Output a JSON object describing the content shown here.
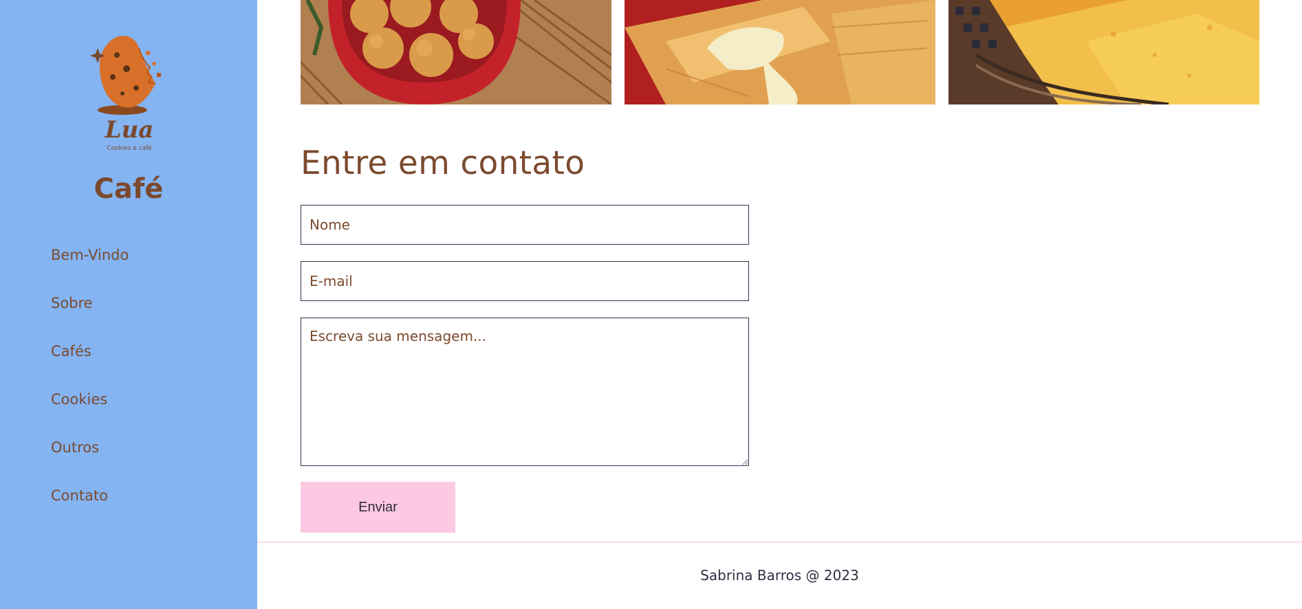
{
  "sidebar": {
    "logo": {
      "script_text": "Lua",
      "tagline": "Cookies e café"
    },
    "brand": "Café",
    "nav": [
      {
        "label": "Bem-Vindo"
      },
      {
        "label": "Sobre"
      },
      {
        "label": "Cafés"
      },
      {
        "label": "Cookies"
      },
      {
        "label": "Outros"
      },
      {
        "label": "Contato"
      }
    ]
  },
  "gallery": [
    {
      "icon": "coxinha-photo"
    },
    {
      "icon": "cheese-pastry-photo"
    },
    {
      "icon": "pastel-photo"
    }
  ],
  "contact": {
    "title": "Entre em contato",
    "name_placeholder": "Nome",
    "email_placeholder": "E-mail",
    "message_placeholder": "Escreva sua mensagem...",
    "submit_label": "Enviar"
  },
  "footer": {
    "text": "Sabrina Barros @ 2023"
  },
  "colors": {
    "sidebar_bg": "#84b4f2",
    "brand_brown": "#7b4a2e",
    "button_pink": "#fdc9e2",
    "footer_border": "#f7bfd6"
  }
}
